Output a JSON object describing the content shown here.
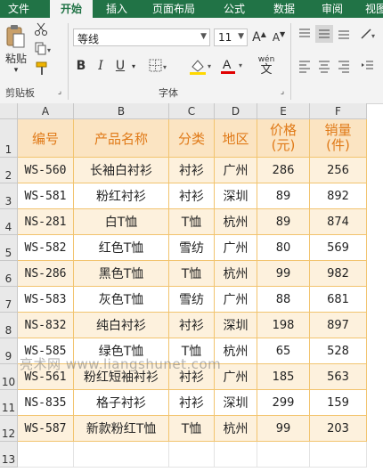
{
  "ribbon": {
    "tabs": [
      "文件",
      "开始",
      "插入",
      "页面布局",
      "公式",
      "数据",
      "审阅",
      "视图"
    ],
    "clipboard": {
      "paste_label": "粘贴",
      "group_label": "剪贴板"
    },
    "font": {
      "name": "等线",
      "size": "11",
      "grow_label": "A",
      "shrink_label": "A",
      "bold": "B",
      "italic": "I",
      "underline": "U",
      "font_color": "A",
      "phonetic": "wén",
      "group_label": "字体"
    },
    "colors": {
      "ribbon_green": "#217346",
      "font_color_red": "#e00000",
      "highlight_yellow": "#ffd800"
    }
  },
  "sheet": {
    "columns": [
      "A",
      "B",
      "C",
      "D",
      "E",
      "F"
    ],
    "rows": [
      "1",
      "2",
      "3",
      "4",
      "5",
      "6",
      "7",
      "8",
      "9",
      "10",
      "11",
      "12",
      "13"
    ],
    "header": [
      "编号",
      "产品名称",
      "分类",
      "地区",
      "价格\n(元)",
      "销量\n(件)"
    ],
    "data": [
      [
        "WS-560",
        "长袖白衬衫",
        "衬衫",
        "广州",
        "286",
        "256"
      ],
      [
        "WS-581",
        "粉红衬衫",
        "衬衫",
        "深圳",
        "89",
        "892"
      ],
      [
        "NS-281",
        "白T恤",
        "T恤",
        "杭州",
        "89",
        "874"
      ],
      [
        "WS-582",
        "红色T恤",
        "雪纺",
        "广州",
        "80",
        "569"
      ],
      [
        "NS-286",
        "黑色T恤",
        "T恤",
        "杭州",
        "99",
        "982"
      ],
      [
        "WS-583",
        "灰色T恤",
        "雪纺",
        "广州",
        "88",
        "681"
      ],
      [
        "NS-832",
        "纯白衬衫",
        "衬衫",
        "深圳",
        "198",
        "897"
      ],
      [
        "WS-585",
        "绿色T恤",
        "T恤",
        "杭州",
        "65",
        "528"
      ],
      [
        "WS-561",
        "粉红短袖衬衫",
        "衬衫",
        "广州",
        "185",
        "563"
      ],
      [
        "NS-835",
        "格子衬衫",
        "衬衫",
        "深圳",
        "299",
        "159"
      ],
      [
        "WS-587",
        "新款粉红T恤",
        "T恤",
        "杭州",
        "99",
        "203"
      ]
    ]
  },
  "watermark": "亮术网 www.liangshunet.com"
}
